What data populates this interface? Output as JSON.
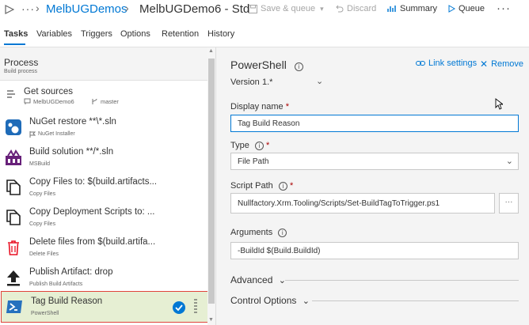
{
  "header": {
    "ellipsis": "···",
    "breadcrumb_project": "MelbUGDemos",
    "breadcrumb_definition": "MelbUGDemo6 - Std",
    "save_label": "Save & queue",
    "discard_label": "Discard",
    "summary_label": "Summary",
    "queue_label": "Queue",
    "more_label": "···"
  },
  "tabs": [
    "Tasks",
    "Variables",
    "Triggers",
    "Options",
    "Retention",
    "History"
  ],
  "process": {
    "title": "Process",
    "subtitle": "Build process"
  },
  "get_sources": {
    "title": "Get sources",
    "repo": "MelbUGDemo6",
    "branch": "master"
  },
  "tasks": [
    {
      "title": "NuGet restore **\\*.sln",
      "subtitle": "NuGet Installer"
    },
    {
      "title": "Build solution **/*.sln",
      "subtitle": "MSBuild"
    },
    {
      "title": "Copy Files to: $(build.artifacts...",
      "subtitle": "Copy Files"
    },
    {
      "title": "Copy Deployment Scripts to: ...",
      "subtitle": "Copy Files"
    },
    {
      "title": "Delete files from $(build.artifa...",
      "subtitle": "Delete Files"
    },
    {
      "title": "Publish Artifact: drop",
      "subtitle": "Publish Build Artifacts"
    },
    {
      "title": "Tag Build Reason",
      "subtitle": "PowerShell"
    }
  ],
  "details": {
    "title": "PowerShell",
    "link_settings": "Link settings",
    "remove": "Remove",
    "version_label": "Version",
    "version_value": "1.*",
    "display_name_label": "Display name",
    "display_name_value": "Tag Build Reason",
    "type_label": "Type",
    "type_value": "File Path",
    "script_path_label": "Script Path",
    "script_path_value": "Nullfactory.Xrm.Tooling/Scripts/Set-BuildTagToTrigger.ps1",
    "arguments_label": "Arguments",
    "arguments_value": "-BuildId $(Build.BuildId)",
    "advanced_label": "Advanced",
    "control_options_label": "Control Options",
    "required_marker": "*",
    "info_glyph": "i"
  },
  "colors": {
    "accent": "#0078d4",
    "selected_bg": "#e6efd3",
    "selected_border": "#e0433b"
  }
}
